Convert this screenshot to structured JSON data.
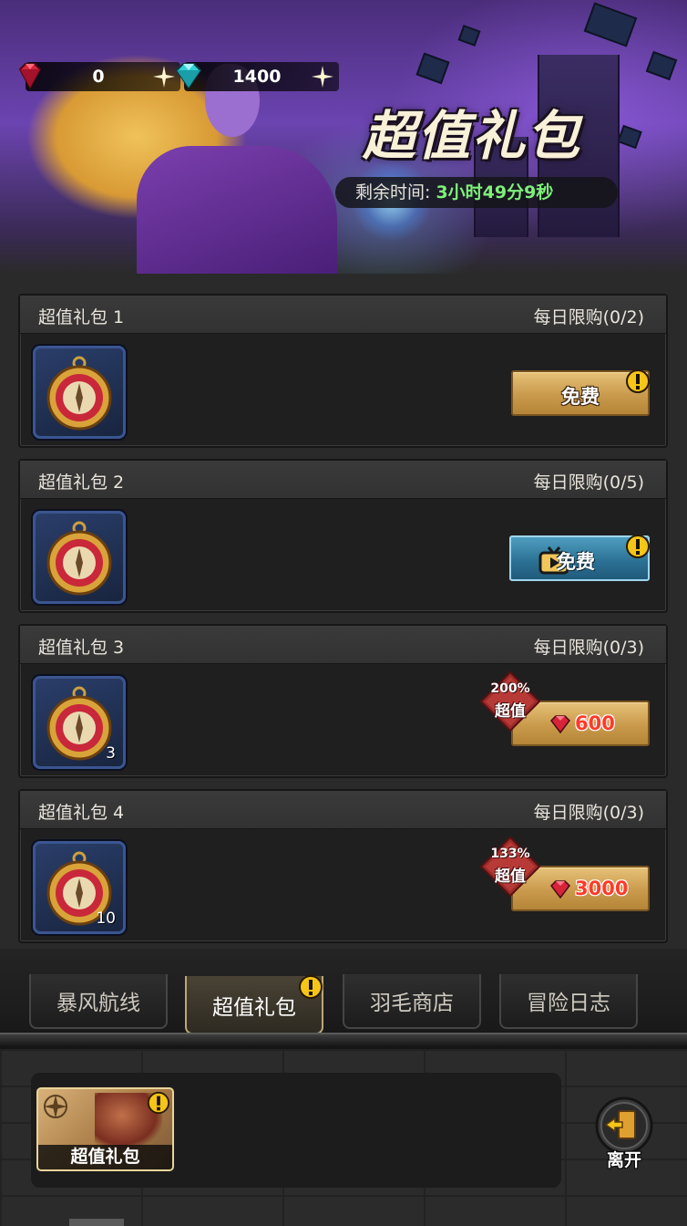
{
  "currencies": [
    {
      "name": "ruby",
      "amount": "0",
      "color": "#d6243a",
      "icon": "ruby-gem-icon"
    },
    {
      "name": "diamond",
      "amount": "1400",
      "color": "#33d0d6",
      "icon": "cyan-diamond-icon"
    }
  ],
  "banner": {
    "title": "超值礼包",
    "timer_label": "剩余时间:",
    "timer_value": "3小时49分9秒"
  },
  "packs": [
    {
      "title": "超值礼包 1",
      "limit": "每日限购(0/2)",
      "item_count": "",
      "button": {
        "type": "free",
        "label": "免费",
        "alert": true
      }
    },
    {
      "title": "超值礼包 2",
      "limit": "每日限购(0/5)",
      "item_count": "",
      "button": {
        "type": "ad",
        "label": "免费",
        "alert": true
      }
    },
    {
      "title": "超值礼包 3",
      "limit": "每日限购(0/3)",
      "item_count": "3",
      "button": {
        "type": "price",
        "label": "600",
        "tag_pct": "200%",
        "tag_word": "超值"
      }
    },
    {
      "title": "超值礼包 4",
      "limit": "每日限购(0/3)",
      "item_count": "10",
      "button": {
        "type": "price",
        "label": "3000",
        "tag_pct": "133%",
        "tag_word": "超值"
      }
    }
  ],
  "tabs": [
    {
      "label": "暴风航线",
      "active": false
    },
    {
      "label": "超值礼包",
      "active": true,
      "alert": true
    },
    {
      "label": "羽毛商店",
      "active": false
    },
    {
      "label": "冒险日志",
      "active": false
    }
  ],
  "activity_card": {
    "label": "超值礼包",
    "alert": true
  },
  "leave_button": {
    "label": "离开",
    "icon": "exit-door-icon"
  },
  "colors": {
    "accent_gold": "#c99a4c",
    "timer_green": "#7ef07a",
    "price_red": "#ff3a2a",
    "alert_yellow": "#f5c518"
  }
}
